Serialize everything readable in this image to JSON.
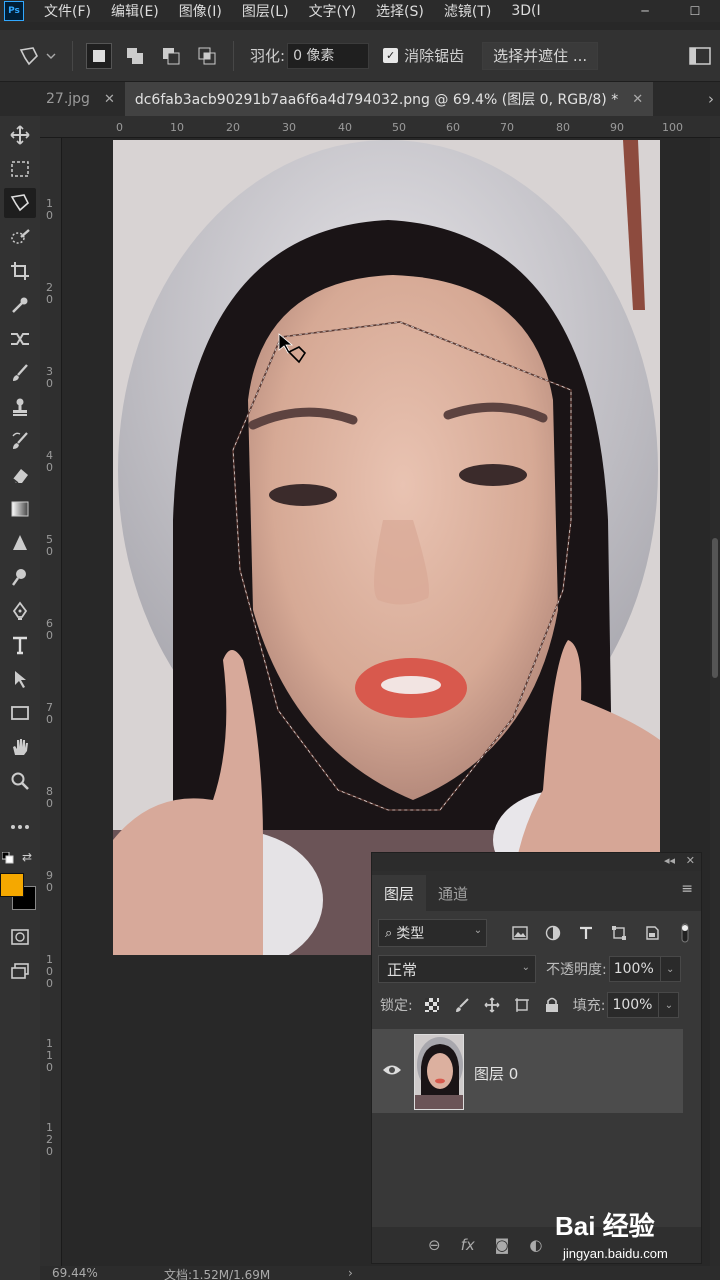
{
  "app": {
    "logo_text": "Ps"
  },
  "menu": [
    "文件(F)",
    "编辑(E)",
    "图像(I)",
    "图层(L)",
    "文字(Y)",
    "选择(S)",
    "滤镜(T)",
    "3D(I"
  ],
  "options": {
    "feather_label": "羽化:",
    "feather_value": "0 像素",
    "antialias_label": "消除锯齿",
    "antialias_checked": true,
    "select_mask_label": "选择并遮住 ..."
  },
  "tabs": [
    {
      "label": "27.jpg",
      "active": false
    },
    {
      "label": "dc6fab3acb90291b7aa6f6a4d794032.png @ 69.4% (图层 0, RGB/8) *",
      "active": true
    }
  ],
  "ruler_top": [
    "0",
    "10",
    "20",
    "30",
    "40",
    "50",
    "60",
    "70",
    "80",
    "90",
    "100"
  ],
  "ruler_left": [
    "1 0",
    "2 0",
    "3 0",
    "4 0",
    "5 0",
    "6 0",
    "7 0",
    "8 0",
    "9 0",
    "1 0 0",
    "1 1 0",
    "1 2 0"
  ],
  "colors": {
    "foreground": "#f5a800",
    "background": "#000000",
    "ui_bg": "#323232",
    "canvas_bg": "#282828"
  },
  "layers_panel": {
    "tabs": [
      "图层",
      "通道"
    ],
    "filter_label": "类型",
    "blend_mode": "正常",
    "opacity_label": "不透明度:",
    "opacity_value": "100%",
    "lock_label": "锁定:",
    "fill_label": "填充:",
    "fill_value": "100%",
    "layer_name": "图层 0",
    "bottom_icons": [
      "link-icon",
      "fx",
      "mask-icon",
      "adjustment-icon"
    ]
  },
  "status": {
    "zoom": "69.44%",
    "doc_size": "文档:1.52M/1.69M"
  },
  "watermark": {
    "logo": "Bai 经验",
    "site": "jingyan.baidu.com"
  }
}
